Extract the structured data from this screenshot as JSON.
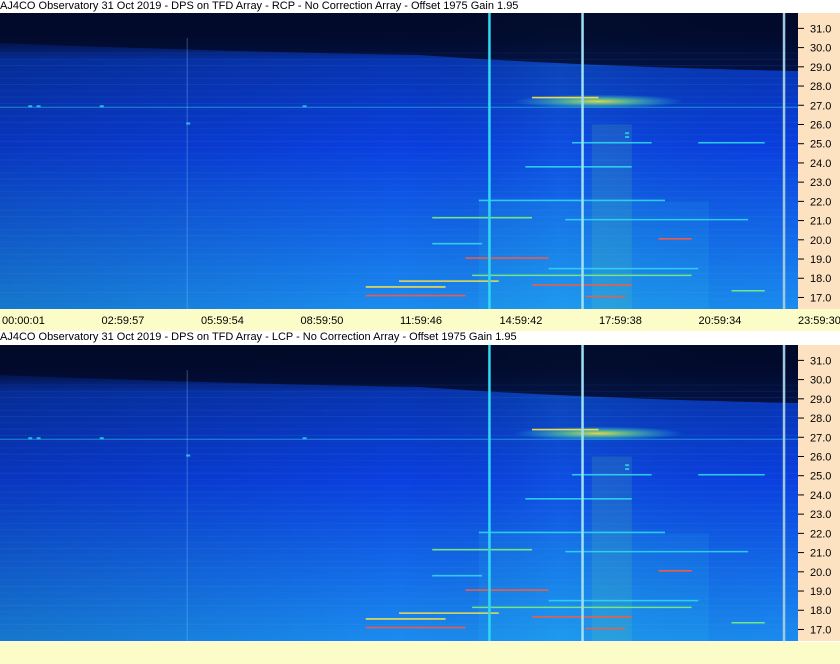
{
  "colors": {
    "background_dark": "#03081c",
    "background_blue": "#0a3fe0",
    "background_light": "#1a8cf0",
    "signal_cyan": "#2fd8f0",
    "signal_green": "#7cf07a",
    "signal_yellow": "#ffe640",
    "signal_red": "#ff5a3a",
    "yaxis_bg": "#fde2c2",
    "xaxis_bg": "#fcfcc8"
  },
  "chart_data": [
    {
      "type": "heatmap",
      "title": "AJ4CO Observatory 31 Oct 2019 - DPS on TFD Array  - RCP  -  No Correction Array  -  Offset 1975  Gain 1.95",
      "x_ticks": [
        "00:00:01",
        "02:59:57",
        "05:59:54",
        "08:59:50",
        "11:59:46",
        "14:59:42",
        "17:59:38",
        "20:59:34",
        "23:59:30"
      ],
      "y_ticks": [
        "31.0",
        "30.0",
        "29.0",
        "28.0",
        "27.0",
        "26.0",
        "25.0",
        "24.0",
        "23.0",
        "22.0",
        "21.0",
        "20.0",
        "19.0",
        "18.0",
        "17.0"
      ],
      "ylim": [
        16.4,
        31.8
      ],
      "xlim_hours": [
        0,
        24
      ]
    },
    {
      "type": "heatmap",
      "title": "AJ4CO Observatory 31 Oct 2019 - DPS on TFD Array  - LCP  -  No Correction Array  -  Offset 1975  Gain 1.95",
      "x_ticks": [],
      "y_ticks": [
        "31.0",
        "30.0",
        "29.0",
        "28.0",
        "27.0",
        "26.0",
        "25.0",
        "24.0",
        "23.0",
        "22.0",
        "21.0",
        "20.0",
        "19.0",
        "18.0",
        "17.0"
      ],
      "ylim": [
        16.4,
        31.8
      ],
      "xlim_hours": [
        0,
        24
      ]
    }
  ]
}
